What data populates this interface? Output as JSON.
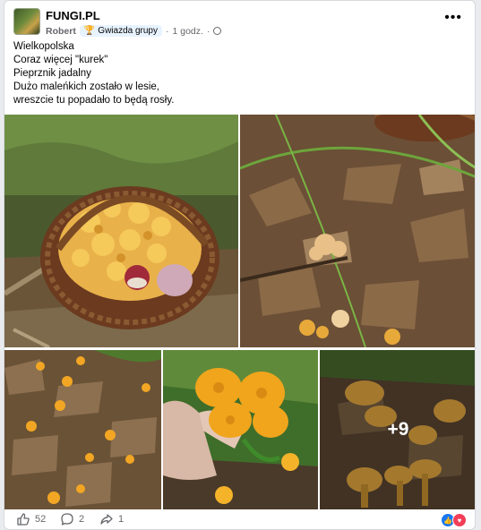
{
  "post": {
    "group_name": "FUNGI.PL",
    "author": "Robert",
    "badge": "Gwiazda grupy",
    "time": "1 godz.",
    "separator": "·",
    "text_lines": [
      "Wielkopolska",
      "Coraz więcej \"kurek\"",
      "Pieprznik jadalny",
      "Dużo maleńkich zostało w lesie,",
      "wreszcie tu popadało to będą rosły."
    ],
    "more_photos": "+9"
  },
  "footer": {
    "likes": "52",
    "comments": "2",
    "shares": "1"
  },
  "icons": {
    "menu": "more-dots-icon",
    "badge": "trophy-icon",
    "privacy": "globe-icon",
    "like": "thumbs-up-icon",
    "comment": "comment-bubble-icon",
    "share": "share-arrow-icon",
    "reaction_like": "like-reaction-icon",
    "reaction_love": "love-reaction-icon"
  },
  "colors": {
    "accent": "#1877f2",
    "love": "#f33e58",
    "chanterelle": "#f2a623"
  }
}
